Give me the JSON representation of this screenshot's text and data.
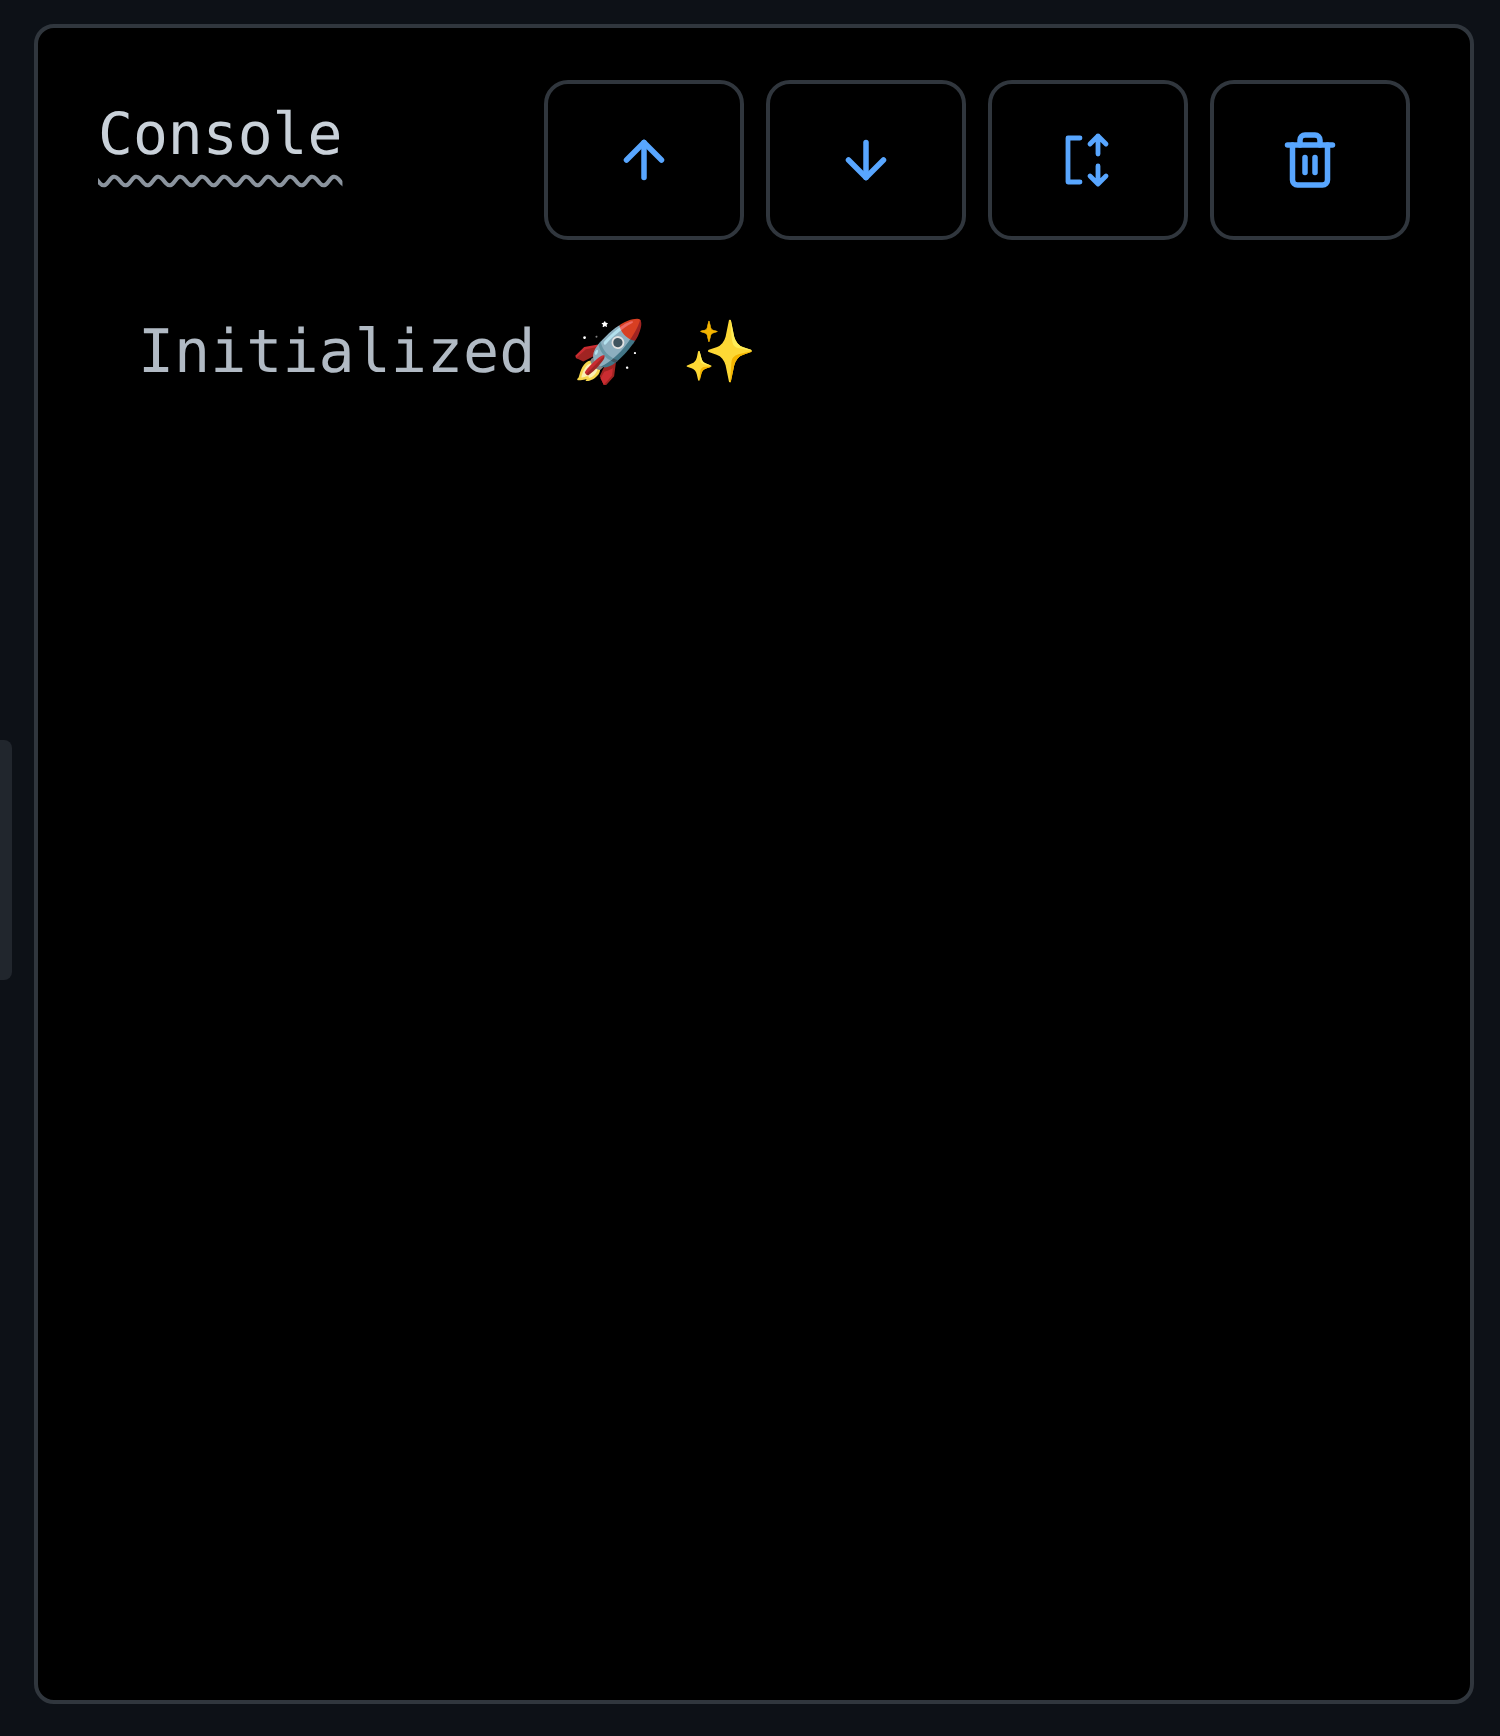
{
  "panel": {
    "title": "Console"
  },
  "buttons": [
    {
      "kind": "up"
    },
    {
      "kind": "down"
    },
    {
      "kind": "fit"
    },
    {
      "kind": "clear"
    }
  ],
  "lines": [
    "Initialized 🚀 ✨"
  ]
}
